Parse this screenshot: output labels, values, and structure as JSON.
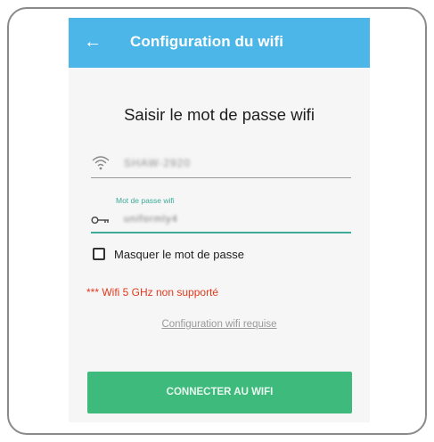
{
  "app_bar": {
    "back_icon": "arrow-left-icon",
    "title": "Configuration du wifi",
    "background": "#4db6e8"
  },
  "heading": "Saisir le mot de passe wifi",
  "ssid_field": {
    "icon": "wifi-icon",
    "value": "SHAW-2920"
  },
  "password_field": {
    "label": "Mot de passe wifi",
    "icon": "key-icon",
    "value": "uniformly4",
    "accent": "#3eaa9a"
  },
  "checkbox": {
    "label": "Masquer le mot de passe",
    "checked": false
  },
  "warning": "*** Wifi 5 GHz non supporté",
  "link": "Configuration wifi requise",
  "connect_button": {
    "label": "CONNECTER AU WIFI",
    "background": "#3fba7d"
  }
}
